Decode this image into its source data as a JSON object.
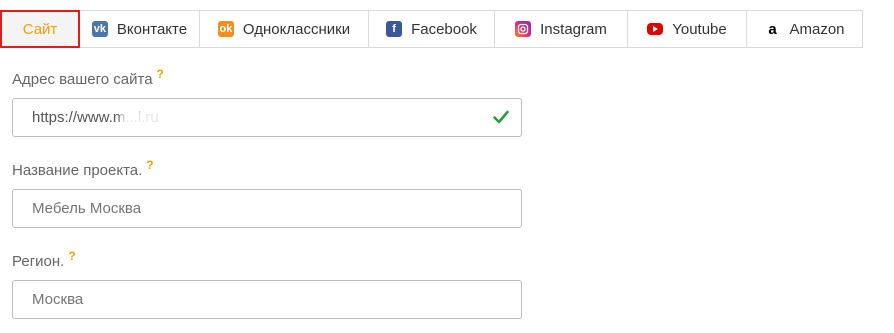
{
  "tabs": [
    {
      "label": "Сайт",
      "icon": "",
      "active": true
    },
    {
      "label": "Вконтакте",
      "icon": "vk-icon",
      "color": "#4a76a8"
    },
    {
      "label": "Одноклассники",
      "icon": "odnoklassniki-icon",
      "color": "#f28d1e"
    },
    {
      "label": "Facebook",
      "icon": "facebook-icon",
      "color": "#3b5998"
    },
    {
      "label": "Instagram",
      "icon": "instagram-icon",
      "color": "#c13584"
    },
    {
      "label": "Youtube",
      "icon": "youtube-icon",
      "color": "#e00000"
    },
    {
      "label": "Amazon",
      "icon": "amazon-icon",
      "color": "#000000"
    }
  ],
  "form": {
    "site": {
      "label": "Адрес вашего сайта",
      "help": "?",
      "value": "https://www.m...l.ru"
    },
    "project": {
      "label": "Название проекта.",
      "help": "?",
      "placeholder": "Мебель Москва"
    },
    "region": {
      "label": "Регион.",
      "help": "?",
      "placeholder": "Москва"
    }
  },
  "colors": {
    "accent": "#f0a00a",
    "highlight": "#e31b1b",
    "valid": "#2e9a3c"
  }
}
